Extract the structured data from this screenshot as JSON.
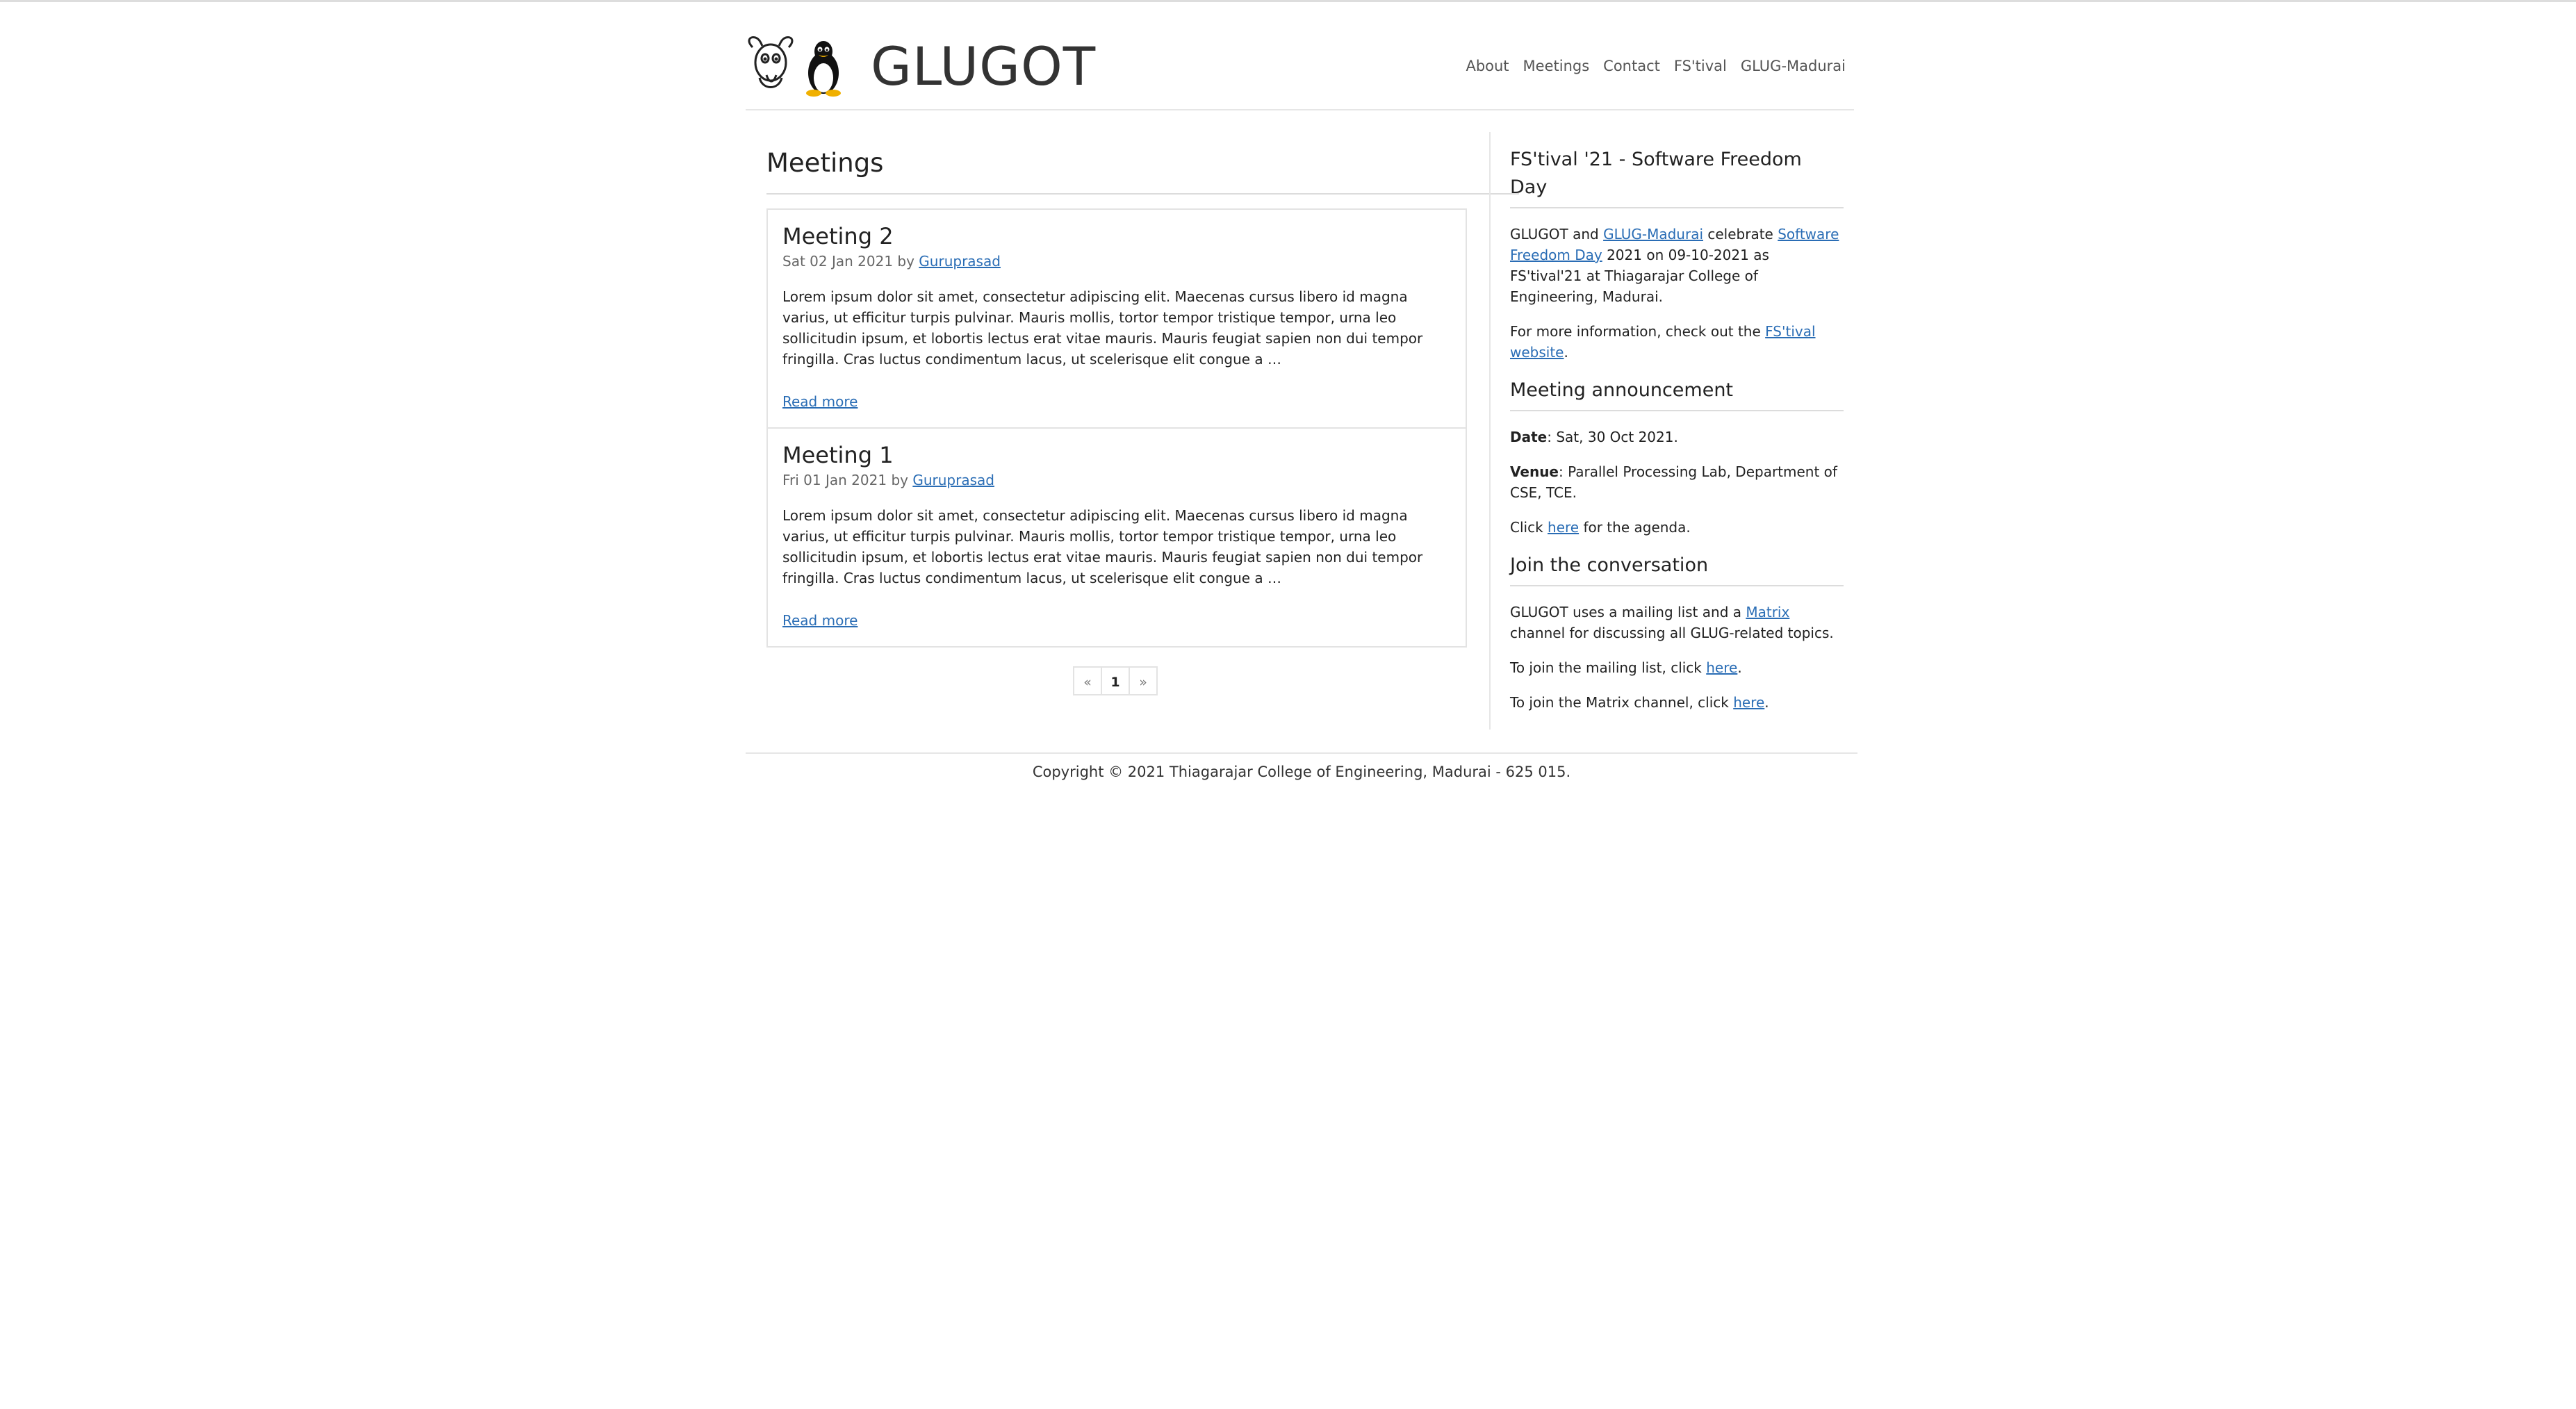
{
  "site": {
    "title": "GLUGOT",
    "nav": [
      "About",
      "Meetings",
      "Contact",
      "FS'tival",
      "GLUG-Madurai"
    ]
  },
  "main": {
    "heading": "Meetings",
    "posts": [
      {
        "title": "Meeting 2",
        "date": "Sat 02 Jan 2021",
        "by": "by",
        "author": "Guruprasad",
        "excerpt": "Lorem ipsum dolor sit amet, consectetur adipiscing elit. Maecenas cursus libero id magna varius, ut efficitur turpis pulvinar. Mauris mollis, tortor tempor tristique tempor, urna leo sollicitudin ipsum, et lobortis lectus erat vitae mauris. Mauris feugiat sapien non dui tempor fringilla. Cras luctus condimentum lacus, ut scelerisque elit congue a …",
        "read_more": "Read more"
      },
      {
        "title": "Meeting 1",
        "date": "Fri 01 Jan 2021",
        "by": "by",
        "author": "Guruprasad",
        "excerpt": "Lorem ipsum dolor sit amet, consectetur adipiscing elit. Maecenas cursus libero id magna varius, ut efficitur turpis pulvinar. Mauris mollis, tortor tempor tristique tempor, urna leo sollicitudin ipsum, et lobortis lectus erat vitae mauris. Mauris feugiat sapien non dui tempor fringilla. Cras luctus condimentum lacus, ut scelerisque elit congue a …",
        "read_more": "Read more"
      }
    ],
    "pagination": {
      "prev": "«",
      "current": "1",
      "next": "»"
    }
  },
  "sidebar": {
    "festival": {
      "heading": "FS'tival '21 - Software Freedom Day",
      "p1_a": "GLUGOT and ",
      "p1_link1": "GLUG-Madurai",
      "p1_b": " celebrate ",
      "p1_link2": "Software Freedom Day",
      "p1_c": " 2021 on 09-10-2021 as FS'tival'21 at Thiagarajar College of Engineering, Madurai.",
      "p2_a": "For more information, check out the ",
      "p2_link": "FS'tival website",
      "p2_b": "."
    },
    "announcement": {
      "heading": "Meeting announcement",
      "date_label": "Date",
      "date_value": ": Sat, 30 Oct 2021.",
      "venue_label": "Venue",
      "venue_value": ": Parallel Processing Lab, Department of CSE, TCE.",
      "click_a": "Click ",
      "click_link": "here",
      "click_b": " for the agenda."
    },
    "conversation": {
      "heading": "Join the conversation",
      "p1_a": "GLUGOT uses a mailing list and a ",
      "p1_link": "Matrix",
      "p1_b": " channel for discussing all GLUG-related topics.",
      "p2_a": "To join the mailing list, click ",
      "p2_link": "here",
      "p2_b": ".",
      "p3_a": "To join the Matrix channel, click ",
      "p3_link": "here",
      "p3_b": "."
    }
  },
  "footer": {
    "copyright": "Copyright © 2021 Thiagarajar College of Engineering, Madurai - 625 015."
  }
}
